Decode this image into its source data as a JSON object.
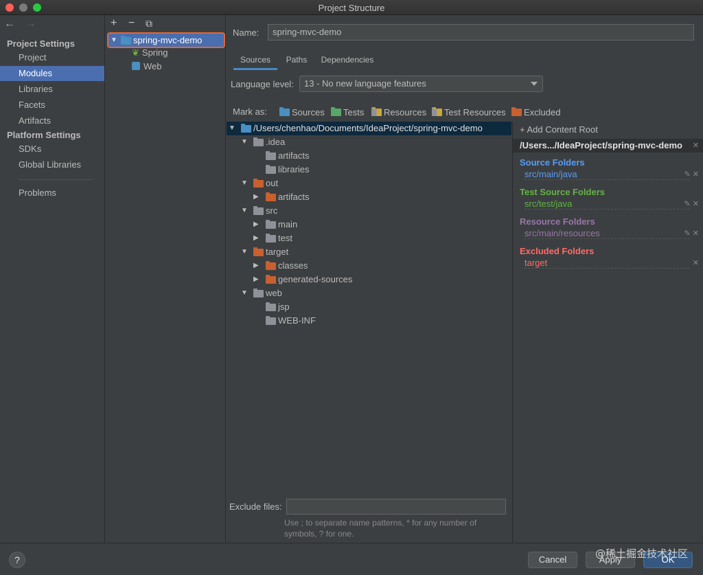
{
  "window": {
    "title": "Project Structure"
  },
  "nav": {
    "back": "←",
    "forward": "→",
    "project_settings": "Project Settings",
    "platform_settings": "Platform Settings",
    "items": [
      {
        "label": "Project"
      },
      {
        "label": "Modules"
      },
      {
        "label": "Libraries"
      },
      {
        "label": "Facets"
      },
      {
        "label": "Artifacts"
      },
      {
        "label": "SDKs"
      },
      {
        "label": "Global Libraries"
      },
      {
        "label": "Problems"
      }
    ]
  },
  "modules": {
    "toolbar": {
      "add": "+",
      "remove": "−",
      "copy": "⧉"
    },
    "root": "spring-mvc-demo",
    "children": [
      "Spring",
      "Web"
    ]
  },
  "main": {
    "name_label": "Name:",
    "name_value": "spring-mvc-demo",
    "tabs": [
      "Sources",
      "Paths",
      "Dependencies"
    ],
    "language_label": "Language level:",
    "language_value": "13 - No new language features",
    "mark_as": "Mark as:",
    "mark_buttons": [
      "Sources",
      "Tests",
      "Resources",
      "Test Resources",
      "Excluded"
    ],
    "tree": [
      "/Users/chenhao/Documents/IdeaProject/spring-mvc-demo",
      ".idea",
      "artifacts",
      "libraries",
      "out",
      "artifacts",
      "src",
      "main",
      "test",
      "target",
      "classes",
      "generated-sources",
      "web",
      "jsp",
      "WEB-INF"
    ],
    "exclude_label": "Exclude files:",
    "exclude_hint": "Use ; to separate name patterns, * for any number of symbols, ? for one."
  },
  "roots": {
    "add": "+ Add Content Root",
    "path": "/Users.../IdeaProject/spring-mvc-demo",
    "source_head": "Source Folders",
    "source_item": "src/main/java",
    "test_head": "Test Source Folders",
    "test_item": "src/test/java",
    "resource_head": "Resource Folders",
    "resource_item": "src/main/resources",
    "excluded_head": "Excluded Folders",
    "excluded_item": "target"
  },
  "colors": {
    "source": "#589df6",
    "test": "#62b543",
    "resource": "#9876aa",
    "excluded": "#ff6b68",
    "selection": "#4b6eaf"
  },
  "footer": {
    "help": "?",
    "cancel": "Cancel",
    "apply": "Apply",
    "ok": "OK",
    "watermark": "@稀土掘金技术社区"
  }
}
